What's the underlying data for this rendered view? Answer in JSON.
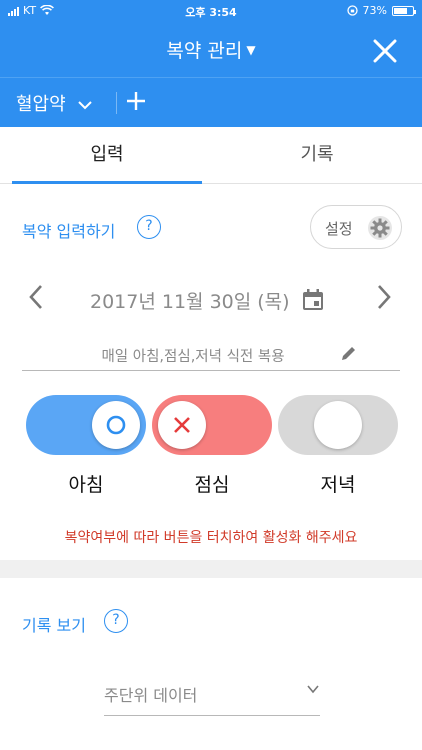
{
  "status": {
    "carrier": "KT",
    "time": "오후 3:54",
    "battery": "73%",
    "battery_level": 0.73
  },
  "appbar": {
    "title": "복약 관리"
  },
  "subbar": {
    "medicine": "혈압약"
  },
  "tabs": [
    {
      "label": "입력"
    },
    {
      "label": "기록"
    }
  ],
  "input_section": {
    "title": "복약 입력하기",
    "help": "?",
    "settings_label": "설정"
  },
  "date": {
    "text": "2017년 11월 30일 (목)"
  },
  "memo": {
    "text": "매일 아침,점심,저녁 식전 복용"
  },
  "meals": [
    {
      "label": "아침",
      "state": "taken"
    },
    {
      "label": "점심",
      "state": "missed"
    },
    {
      "label": "저녁",
      "state": "none"
    }
  ],
  "notice": "복약여부에 따라 버튼을 터치하여 활성화 해주세요",
  "record_section": {
    "title": "기록 보기",
    "help": "?"
  },
  "period_select": {
    "value": "주단위 데이터"
  },
  "colors": {
    "primary": "#2e8ff0",
    "taken": "#5aa6f5",
    "missed": "#f77e7e",
    "none": "#d8d8d8",
    "notice": "#d13b2a"
  }
}
